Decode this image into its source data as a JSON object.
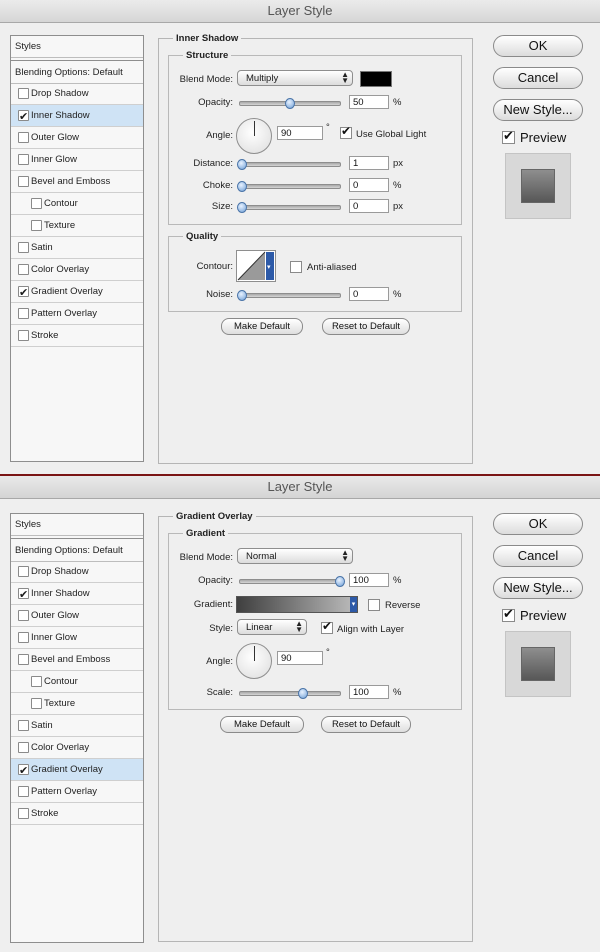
{
  "dialogs": [
    {
      "title": "Layer Style",
      "styles_header": "Styles",
      "blending": "Blending Options: Default",
      "items": [
        {
          "label": "Drop Shadow",
          "checked": false,
          "selected": false,
          "sub": false
        },
        {
          "label": "Inner Shadow",
          "checked": true,
          "selected": true,
          "sub": false
        },
        {
          "label": "Outer Glow",
          "checked": false,
          "selected": false,
          "sub": false
        },
        {
          "label": "Inner Glow",
          "checked": false,
          "selected": false,
          "sub": false
        },
        {
          "label": "Bevel and Emboss",
          "checked": false,
          "selected": false,
          "sub": false
        },
        {
          "label": "Contour",
          "checked": false,
          "selected": false,
          "sub": true
        },
        {
          "label": "Texture",
          "checked": false,
          "selected": false,
          "sub": true
        },
        {
          "label": "Satin",
          "checked": false,
          "selected": false,
          "sub": false
        },
        {
          "label": "Color Overlay",
          "checked": false,
          "selected": false,
          "sub": false
        },
        {
          "label": "Gradient Overlay",
          "checked": true,
          "selected": false,
          "sub": false
        },
        {
          "label": "Pattern Overlay",
          "checked": false,
          "selected": false,
          "sub": false
        },
        {
          "label": "Stroke",
          "checked": false,
          "selected": false,
          "sub": false
        }
      ],
      "panel_title": "Inner Shadow",
      "structure": {
        "legend": "Structure",
        "blend_mode_label": "Blend Mode:",
        "blend_mode": "Multiply",
        "shadow_color": "#000000",
        "opacity_label": "Opacity:",
        "opacity": "50",
        "angle_label": "Angle:",
        "angle": "90",
        "global_light_label": "Use Global Light",
        "global_light": true,
        "distance_label": "Distance:",
        "distance": "1",
        "choke_label": "Choke:",
        "choke": "0",
        "size_label": "Size:",
        "size": "0",
        "unit_percent": "%",
        "unit_px": "px",
        "unit_degree": "°"
      },
      "quality": {
        "legend": "Quality",
        "contour_label": "Contour:",
        "anti_aliased_label": "Anti-aliased",
        "anti_aliased": false,
        "noise_label": "Noise:",
        "noise": "0"
      },
      "make_default": "Make Default",
      "reset_default": "Reset to Default",
      "ok": "OK",
      "cancel": "Cancel",
      "new_style": "New Style...",
      "preview": "Preview"
    },
    {
      "title": "Layer Style",
      "styles_header": "Styles",
      "blending": "Blending Options: Default",
      "items": [
        {
          "label": "Drop Shadow",
          "checked": false,
          "selected": false,
          "sub": false
        },
        {
          "label": "Inner Shadow",
          "checked": true,
          "selected": false,
          "sub": false
        },
        {
          "label": "Outer Glow",
          "checked": false,
          "selected": false,
          "sub": false
        },
        {
          "label": "Inner Glow",
          "checked": false,
          "selected": false,
          "sub": false
        },
        {
          "label": "Bevel and Emboss",
          "checked": false,
          "selected": false,
          "sub": false
        },
        {
          "label": "Contour",
          "checked": false,
          "selected": false,
          "sub": true
        },
        {
          "label": "Texture",
          "checked": false,
          "selected": false,
          "sub": true
        },
        {
          "label": "Satin",
          "checked": false,
          "selected": false,
          "sub": false
        },
        {
          "label": "Color Overlay",
          "checked": false,
          "selected": false,
          "sub": false
        },
        {
          "label": "Gradient Overlay",
          "checked": true,
          "selected": true,
          "sub": false
        },
        {
          "label": "Pattern Overlay",
          "checked": false,
          "selected": false,
          "sub": false
        },
        {
          "label": "Stroke",
          "checked": false,
          "selected": false,
          "sub": false
        }
      ],
      "panel_title": "Gradient Overlay",
      "gradient": {
        "legend": "Gradient",
        "blend_mode_label": "Blend Mode:",
        "blend_mode": "Normal",
        "opacity_label": "Opacity:",
        "opacity": "100",
        "gradient_label": "Gradient:",
        "reverse_label": "Reverse",
        "reverse": false,
        "style_label": "Style:",
        "style": "Linear",
        "align_label": "Align with Layer",
        "align": true,
        "angle_label": "Angle:",
        "angle": "90",
        "scale_label": "Scale:",
        "scale": "100",
        "unit_percent": "%",
        "unit_degree": "°"
      },
      "make_default": "Make Default",
      "reset_default": "Reset to Default",
      "ok": "OK",
      "cancel": "Cancel",
      "new_style": "New Style...",
      "preview": "Preview"
    }
  ],
  "colors": {
    "selection": "#cfe3f5",
    "slider_thumb": "#6f9fd6",
    "separator": "#7a1414"
  }
}
